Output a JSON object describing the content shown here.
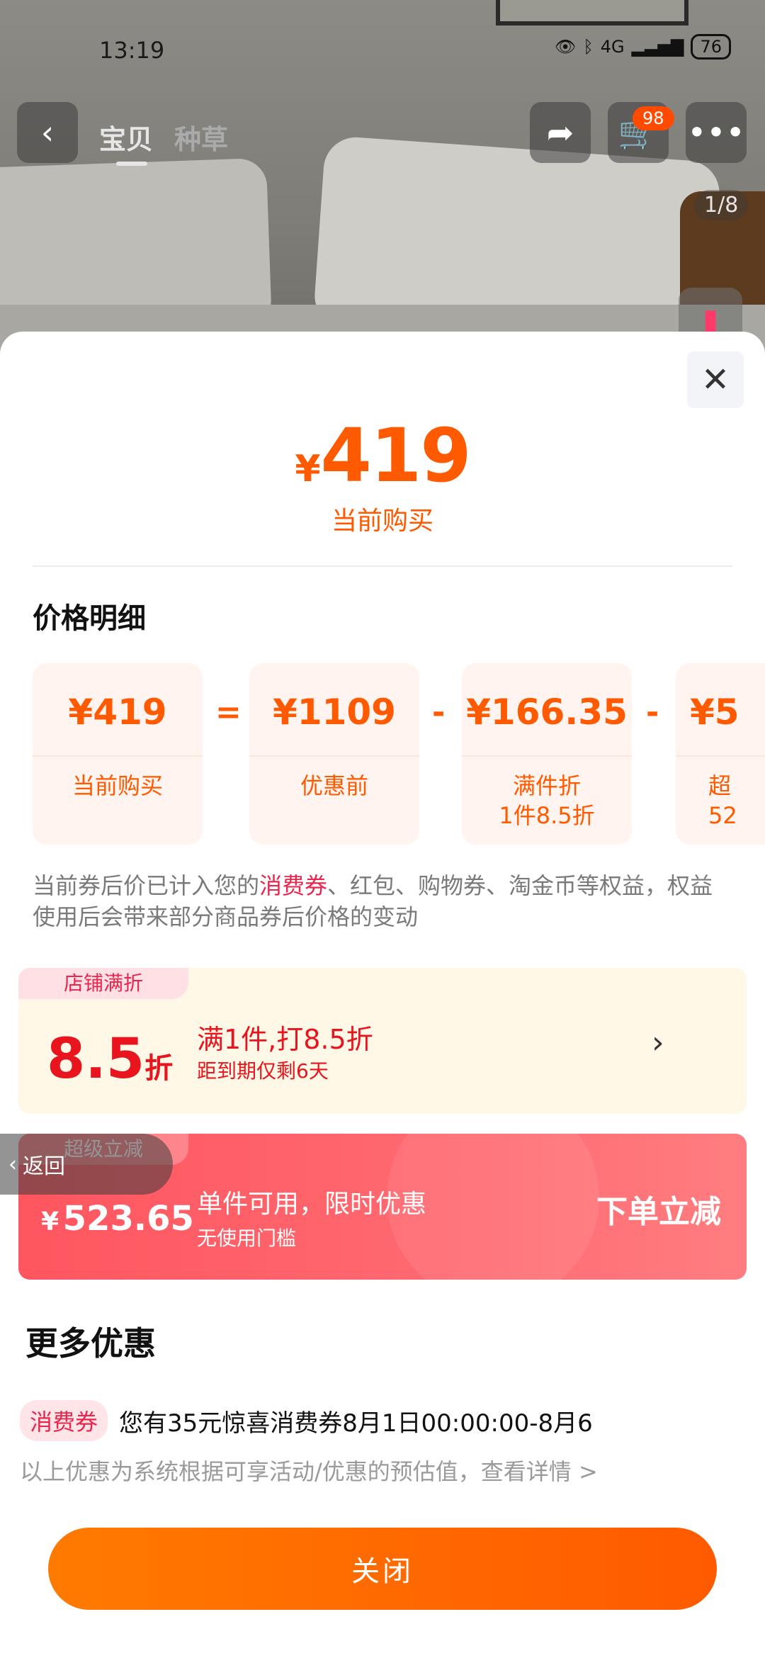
{
  "status_bar": {
    "time": "13:19",
    "network": "4G",
    "battery": "76"
  },
  "top_nav": {
    "tabs": [
      {
        "label": "宝贝",
        "active": true
      },
      {
        "label": "种草",
        "active": false
      }
    ],
    "cart_badge": "98",
    "image_pager": "1/8"
  },
  "summary": {
    "currency": "¥",
    "price": "419",
    "label": "当前购买"
  },
  "price_detail": {
    "title": "价格明细",
    "cards": [
      {
        "amount": "¥419",
        "desc": "当前购买"
      },
      {
        "amount": "¥1109",
        "desc": "优惠前"
      },
      {
        "amount": "¥166.35",
        "desc": "满件折\n1件8.5折"
      },
      {
        "amount": "¥5",
        "desc": "超\n52"
      }
    ],
    "operators": [
      "=",
      "-",
      "-"
    ]
  },
  "note": {
    "prefix": "当前券后价已计入您的",
    "highlight": "消费券",
    "suffix": "、红包、购物券、淘金币等权益，权益使用后会带来部分商品券后价格的变动"
  },
  "store_discount": {
    "tag": "店铺满折",
    "value": "8.5",
    "unit": "折",
    "line1": "满1件,打8.5折",
    "line2": "距到期仅剩6天"
  },
  "super_discount": {
    "tag": "超级立减",
    "currency": "¥",
    "amount": "523.65",
    "line1": "单件可用，限时优惠",
    "line2": "无使用门槛",
    "button": "下单立减"
  },
  "back_pill": {
    "label": "返回"
  },
  "more": {
    "title": "更多优惠",
    "coupon_tag": "消费券",
    "coupon_text": "您有35元惊喜消费券8月1日00:00:00-8月6",
    "disclaimer": "以上优惠为系统根据可享活动/优惠的预估值，查看详情 >"
  },
  "close_button": "关闭",
  "colors": {
    "accent": "#ff5a00",
    "red": "#e8141e",
    "super_bg": "#ff5660"
  }
}
